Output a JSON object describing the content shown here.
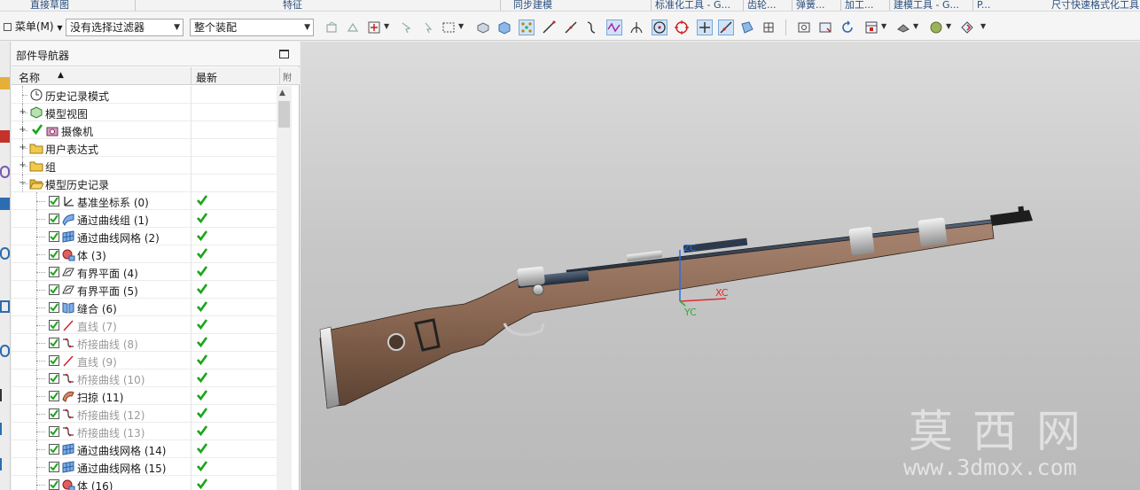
{
  "ribbon_groups": [
    "直接草图",
    "特征",
    "同步建模",
    "标准化工具 - G...",
    "齿轮...",
    "弹簧...",
    "加工...",
    "建模工具 - G...",
    "P...",
    "尺寸快速格式化工具"
  ],
  "toolbar": {
    "menu_label": "菜单(M)",
    "filter_value": "没有选择过滤器",
    "assembly_value": "整个装配"
  },
  "navigator": {
    "title": "部件导航器",
    "columns": {
      "name": "名称",
      "latest": "最新",
      "extra": "附"
    },
    "items": [
      {
        "label": "历史记录模式",
        "icon": "history-clock-icon",
        "kind": "root"
      },
      {
        "label": "模型视图",
        "icon": "model-views-icon",
        "kind": "expandable"
      },
      {
        "label": "摄像机",
        "icon": "camera-icon",
        "kind": "expandable-check"
      },
      {
        "label": "用户表达式",
        "icon": "folder-icon",
        "kind": "expandable"
      },
      {
        "label": "组",
        "icon": "folder-icon",
        "kind": "expandable"
      },
      {
        "label": "模型历史记录",
        "icon": "folder-open-icon",
        "kind": "expanded"
      },
      {
        "label": "基准坐标系 (0)",
        "icon": "datum-csys-icon",
        "kind": "feature",
        "latest": true
      },
      {
        "label": "通过曲线组 (1)",
        "icon": "through-curves-icon",
        "kind": "feature",
        "latest": true
      },
      {
        "label": "通过曲线网格 (2)",
        "icon": "curve-mesh-icon",
        "kind": "feature",
        "latest": true
      },
      {
        "label": "体 (3)",
        "icon": "body-icon",
        "kind": "feature",
        "latest": true
      },
      {
        "label": "有界平面 (4)",
        "icon": "bounded-plane-icon",
        "kind": "feature",
        "latest": true
      },
      {
        "label": "有界平面 (5)",
        "icon": "bounded-plane-icon",
        "kind": "feature",
        "latest": true
      },
      {
        "label": "缝合 (6)",
        "icon": "sew-icon",
        "kind": "feature",
        "latest": true
      },
      {
        "label": "直线 (7)",
        "icon": "line-icon",
        "kind": "feature-dim",
        "latest": true
      },
      {
        "label": "桥接曲线 (8)",
        "icon": "bridge-curve-icon",
        "kind": "feature-dim",
        "latest": true
      },
      {
        "label": "直线 (9)",
        "icon": "line-icon",
        "kind": "feature-dim",
        "latest": true
      },
      {
        "label": "桥接曲线 (10)",
        "icon": "bridge-curve-icon",
        "kind": "feature-dim",
        "latest": true
      },
      {
        "label": "扫掠 (11)",
        "icon": "sweep-icon",
        "kind": "feature",
        "latest": true
      },
      {
        "label": "桥接曲线 (12)",
        "icon": "bridge-curve-icon",
        "kind": "feature-dim",
        "latest": true
      },
      {
        "label": "桥接曲线 (13)",
        "icon": "bridge-curve-icon",
        "kind": "feature-dim",
        "latest": true
      },
      {
        "label": "通过曲线网格 (14)",
        "icon": "curve-mesh-icon",
        "kind": "feature",
        "latest": true
      },
      {
        "label": "通过曲线网格 (15)",
        "icon": "curve-mesh-icon",
        "kind": "feature",
        "latest": true
      },
      {
        "label": "体 (16)",
        "icon": "body-icon",
        "kind": "feature",
        "latest": true
      }
    ]
  },
  "viewport": {
    "axis_x": "XC",
    "axis_y": "YC",
    "axis_z": "ZC",
    "watermark_title": "莫西网",
    "watermark_url": "www.3dmox.com"
  },
  "colors": {
    "stock": "#8a6752",
    "metal": "#2c3a4c",
    "check": "#1aa51a",
    "accent": "#2b4f7e"
  }
}
